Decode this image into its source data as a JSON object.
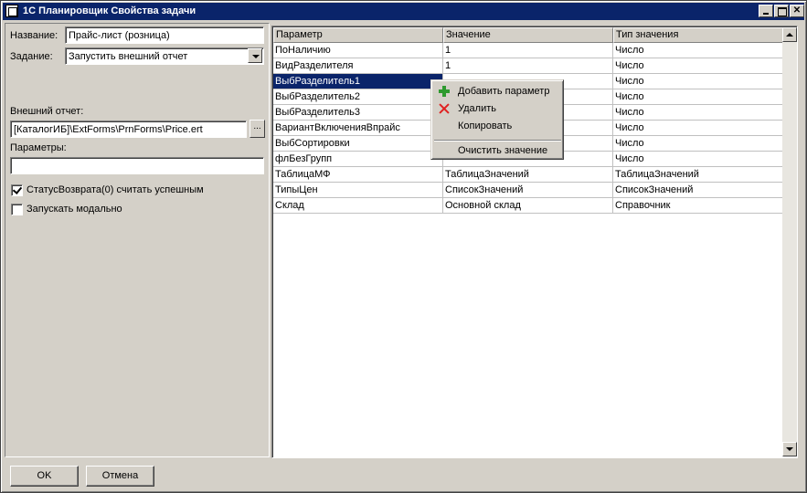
{
  "window": {
    "title": "1С Планировщик Свойства задачи"
  },
  "form": {
    "name_label": "Название:",
    "name_value": "Прайс-лист (розница)",
    "task_label": "Задание:",
    "task_value": "Запустить внешний отчет",
    "ext_report_label": "Внешний отчет:",
    "ext_report_value": "[КаталогИБ]\\ExtForms\\PrnForms\\Price.ert",
    "browse_label": "...",
    "params_label": "Параметры:",
    "params_value": "",
    "status_checkbox_label": "СтатусВозврата(0) считать успешным",
    "status_checked": true,
    "modal_checkbox_label": "Запускать модально",
    "modal_checked": false
  },
  "grid": {
    "columns": [
      "Параметр",
      "Значение",
      "Тип значения"
    ],
    "rows": [
      [
        "ПоНаличию",
        "1",
        "Число"
      ],
      [
        "ВидРазделителя",
        "1",
        "Число"
      ],
      [
        "ВыбРазделитель1",
        "",
        "Число"
      ],
      [
        "ВыбРазделитель2",
        "",
        "Число"
      ],
      [
        "ВыбРазделитель3",
        "",
        "Число"
      ],
      [
        "ВариантВключенияВпрайс",
        "",
        "Число"
      ],
      [
        "ВыбСортировки",
        "",
        "Число"
      ],
      [
        "флБезГрупп",
        "",
        "Число"
      ],
      [
        "ТаблицаМФ",
        "ТаблицаЗначений",
        "ТаблицаЗначений"
      ],
      [
        "ТипыЦен",
        "СписокЗначений",
        "СписокЗначений"
      ],
      [
        "Склад",
        "Основной склад",
        "Справочник"
      ]
    ],
    "selected_row": 2
  },
  "context_menu": {
    "add": "Добавить параметр",
    "delete": "Удалить",
    "copy": "Копировать",
    "clear": "Очистить значение"
  },
  "buttons": {
    "ok": "OK",
    "cancel": "Отмена"
  },
  "colors": {
    "title_bar": "#0a246a",
    "selection": "#0a246a",
    "face": "#d4d0c8"
  }
}
